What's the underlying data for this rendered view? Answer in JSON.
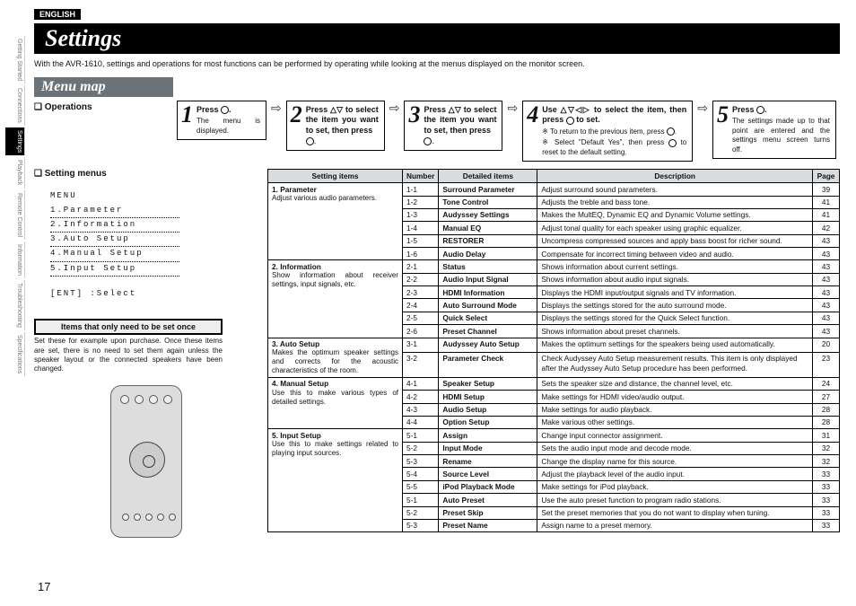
{
  "language": "ENGLISH",
  "side_tabs": [
    "Getting Started",
    "Connections",
    "Settings",
    "Playback",
    "Remote Control",
    "Information",
    "Troubleshooting",
    "Specifications"
  ],
  "side_active_index": 2,
  "h_settings": "Settings",
  "intro": "With the AVR-1610, settings and operations for most functions can be performed by operating while looking at the menus displayed on the monitor screen.",
  "menu_map": "Menu map",
  "operations": "❏ Operations",
  "steps": [
    {
      "n": "1",
      "body": "Press ",
      "body2": ".",
      "sub": "The menu is displayed.",
      "icon": "menu"
    },
    {
      "n": "2",
      "body": "Press △▽ to select the item you want to set, then press",
      "sub": "",
      "icon": "enter",
      "tail": "."
    },
    {
      "n": "3",
      "body": "Press △▽ to select the item you want to set, then press",
      "sub": "",
      "icon": "enter",
      "tail": "."
    },
    {
      "n": "4",
      "body": "Use △▽◁▷ to select the item, then press ",
      "body2": " to set.",
      "note1": "※ To return to the previous item, press ",
      "note1b": ".",
      "note2": "※ Select \"Default Yes\", then press ",
      "note2b": " to reset to the default setting.",
      "icon": "enter"
    },
    {
      "n": "5",
      "body": "Press ",
      "body2": ".",
      "sub": "The settings made up to that point are entered and the settings menu screen turns off.",
      "icon": "menu"
    }
  ],
  "setting_menus_label": "❏ Setting menus",
  "lcd": {
    "title": "MENU",
    "rows": [
      "1.Parameter",
      "2.Information",
      "3.Auto Setup",
      "4.Manual Setup",
      "5.Input Setup"
    ],
    "ent": "[ENT] :Select"
  },
  "once_title": "Items that only need to be set once",
  "once_text": "Set these for example upon purchase.\nOnce these items are set, there is no need to set them again unless the speaker layout or the connected speakers have been changed.",
  "headers": {
    "si": "Setting items",
    "num": "Number",
    "di": "Detailed items",
    "desc": "Description",
    "pg": "Page"
  },
  "groups": [
    {
      "si": "1. Parameter",
      "sidesc": "Adjust various audio parameters.",
      "rows": [
        {
          "n": "1-1",
          "di": "Surround Parameter",
          "d": "Adjust surround sound parameters.",
          "p": "39"
        },
        {
          "n": "1-2",
          "di": "Tone Control",
          "d": "Adjusts the treble and bass tone.",
          "p": "41"
        },
        {
          "n": "1-3",
          "di": "Audyssey Settings",
          "d": "Makes the MultEQ, Dynamic EQ and Dynamic Volume settings.",
          "p": "41"
        },
        {
          "n": "1-4",
          "di": "Manual EQ",
          "d": "Adjust tonal quality for each speaker using graphic equalizer.",
          "p": "42"
        },
        {
          "n": "1-5",
          "di": "RESTORER",
          "d": "Uncompress compressed sources and apply bass boost for richer sound.",
          "p": "43"
        },
        {
          "n": "1-6",
          "di": "Audio Delay",
          "d": "Compensate for incorrect timing between video and audio.",
          "p": "43"
        }
      ]
    },
    {
      "si": "2. Information",
      "sidesc": "Show information about receiver settings, input signals, etc.",
      "rows": [
        {
          "n": "2-1",
          "di": "Status",
          "d": "Shows information about current settings.",
          "p": "43"
        },
        {
          "n": "2-2",
          "di": "Audio Input Signal",
          "d": "Shows information about audio input signals.",
          "p": "43"
        },
        {
          "n": "2-3",
          "di": "HDMI Information",
          "d": "Displays the HDMI input/output signals and TV information.",
          "p": "43"
        },
        {
          "n": "2-4",
          "di": "Auto Surround Mode",
          "d": "Displays the settings stored for the auto surround mode.",
          "p": "43"
        },
        {
          "n": "2-5",
          "di": "Quick Select",
          "d": "Displays the settings stored for the Quick Select function.",
          "p": "43"
        },
        {
          "n": "2-6",
          "di": "Preset Channel",
          "d": "Shows information about preset channels.",
          "p": "43"
        }
      ]
    },
    {
      "si": "3. Auto Setup",
      "sidesc": "Makes the optimum speaker settings and corrects for the acoustic characteristics of the room.",
      "rows": [
        {
          "n": "3-1",
          "di": "Audyssey Auto Setup",
          "d": "Makes the optimum settings for the speakers being used automatically.",
          "p": "20"
        },
        {
          "n": "3-2",
          "di": "Parameter Check",
          "d": "Check Audyssey Auto Setup measurement results.\nThis item is only displayed after the Audyssey Auto Setup procedure has been performed.",
          "p": "23"
        }
      ]
    },
    {
      "si": "4. Manual Setup",
      "sidesc": "Use this to make various types of detailed settings.",
      "rows": [
        {
          "n": "4-1",
          "di": "Speaker Setup",
          "d": "Sets the speaker size and distance, the channel level, etc.",
          "p": "24"
        },
        {
          "n": "4-2",
          "di": "HDMI Setup",
          "d": "Make settings for HDMI video/audio output.",
          "p": "27"
        },
        {
          "n": "4-3",
          "di": "Audio Setup",
          "d": "Make settings for audio playback.",
          "p": "28"
        },
        {
          "n": "4-4",
          "di": "Option Setup",
          "d": "Make various other settings.",
          "p": "28"
        }
      ]
    },
    {
      "si": "5. Input Setup",
      "sidesc": "Use this to make settings related to playing input sources.",
      "rows": [
        {
          "n": "5-1",
          "di": "Assign",
          "d": "Change input connector assignment.",
          "p": "31"
        },
        {
          "n": "5-2",
          "di": "Input Mode",
          "d": "Sets the audio input mode and decode mode.",
          "p": "32"
        },
        {
          "n": "5-3",
          "di": "Rename",
          "d": "Change the display name for this source.",
          "p": "32"
        },
        {
          "n": "5-4",
          "di": "Source Level",
          "d": "Adjust the playback level of the audio input.",
          "p": "33"
        },
        {
          "n": "5-5",
          "di": "iPod Playback Mode",
          "d": "Make settings for iPod playback.",
          "p": "33"
        },
        {
          "n": "5-1",
          "di": "Auto Preset",
          "d": "Use the auto preset function to program radio stations.",
          "p": "33"
        },
        {
          "n": "5-2",
          "di": "Preset Skip",
          "d": "Set the preset memories that you do not want to display when tuning.",
          "p": "33"
        },
        {
          "n": "5-3",
          "di": "Preset Name",
          "d": "Assign name to a preset memory.",
          "p": "33"
        }
      ]
    }
  ],
  "page_number": "17"
}
